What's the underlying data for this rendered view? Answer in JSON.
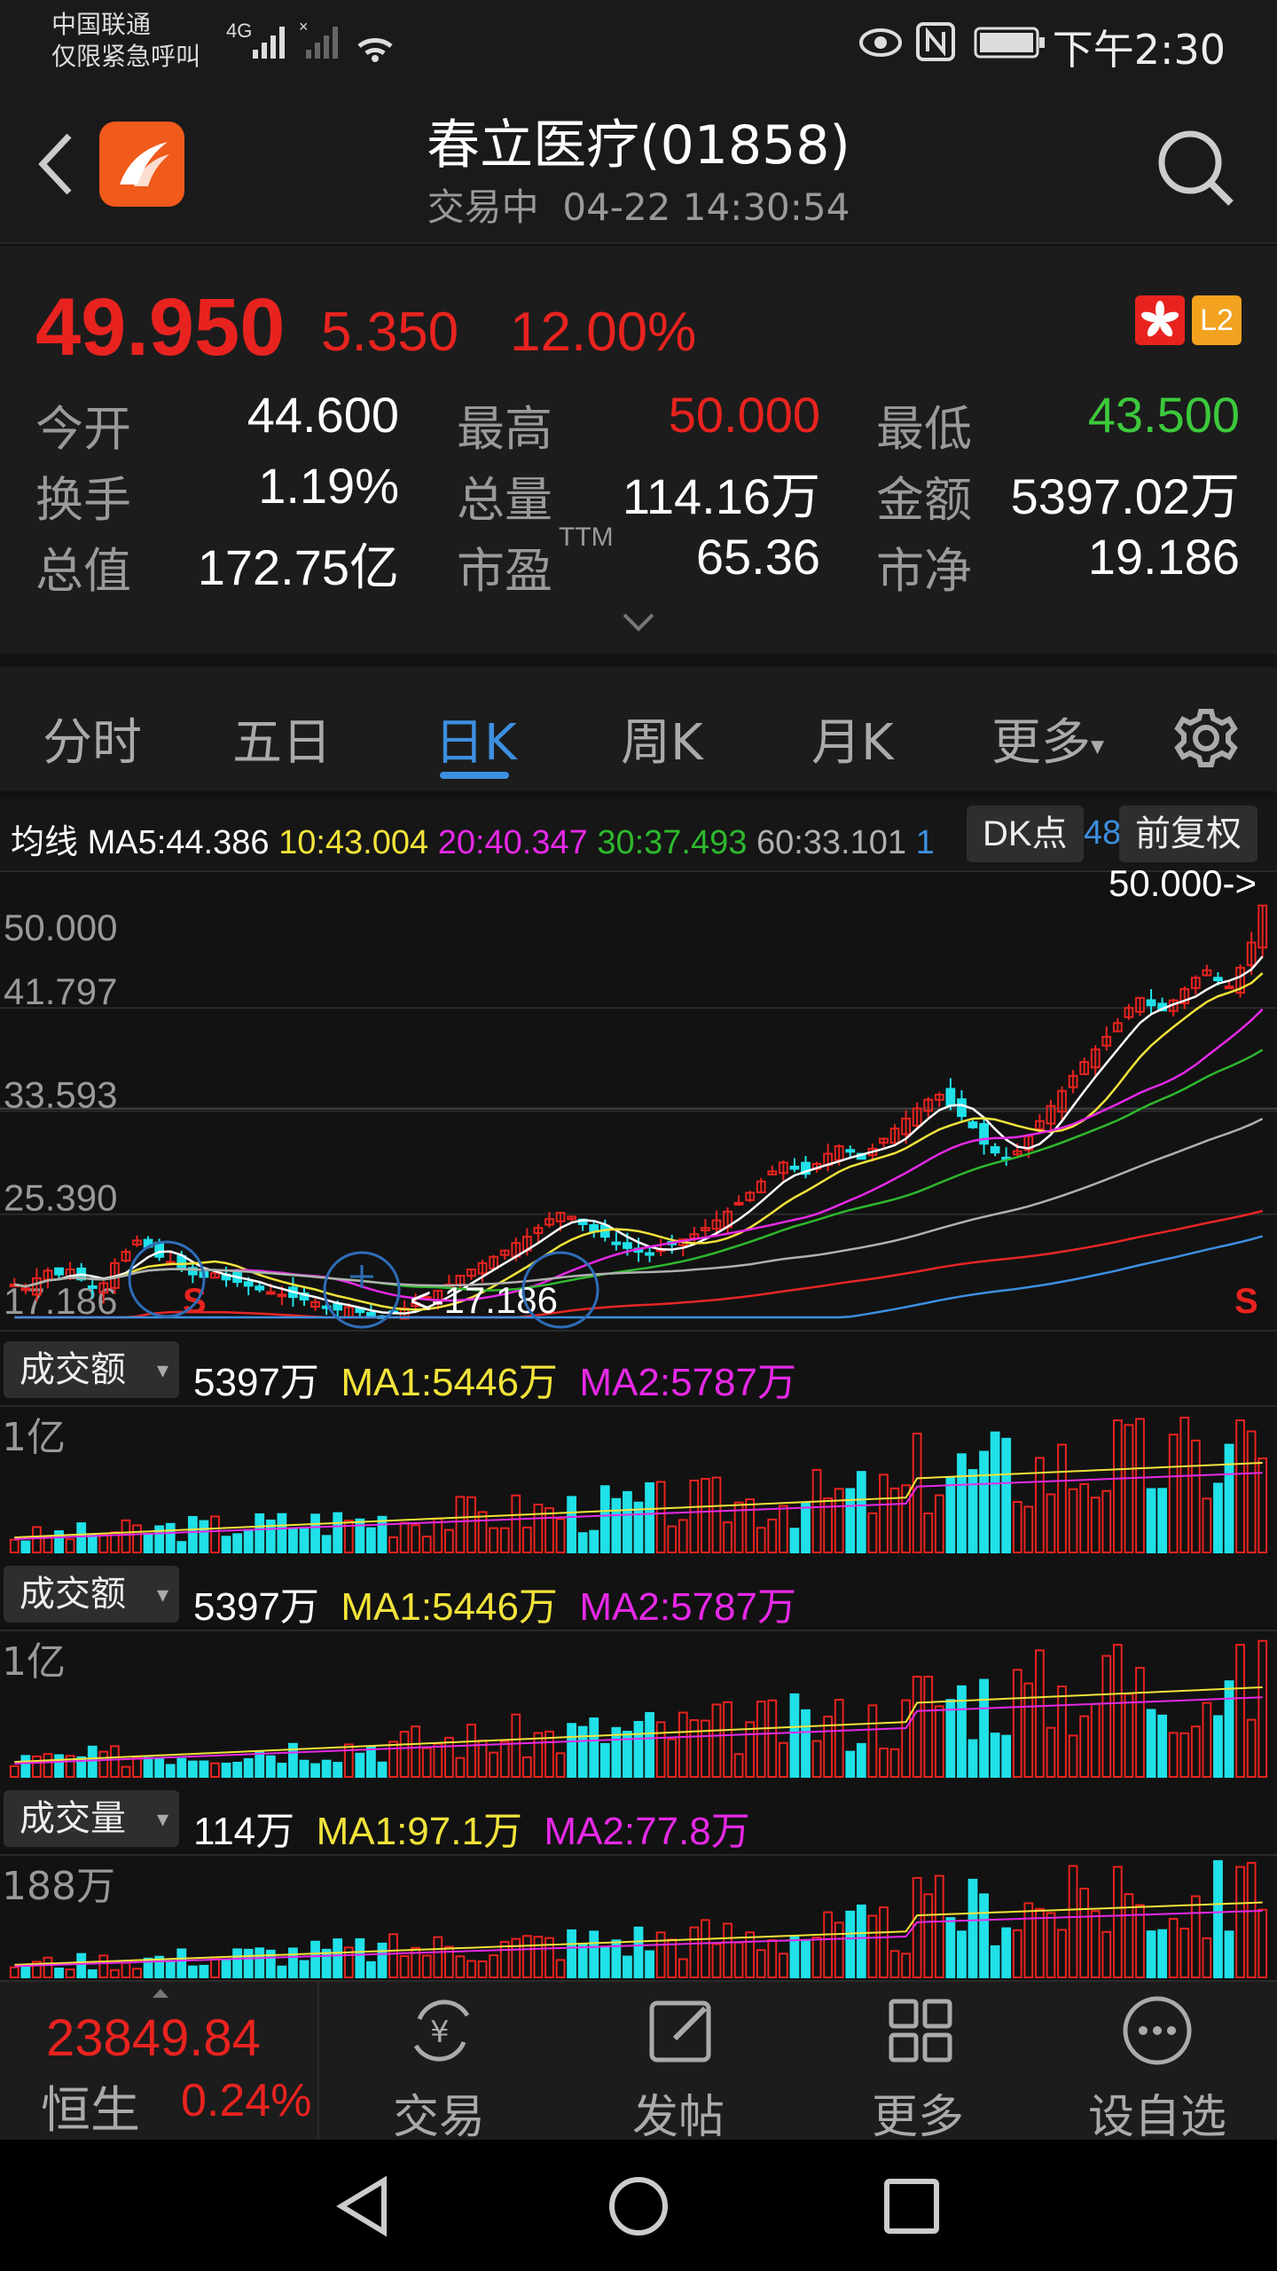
{
  "status_bar": {
    "carrier_line1": "中国联通",
    "carrier_line2": "仅限紧急呼叫",
    "network": "4G",
    "time": "下午2:30"
  },
  "header": {
    "title": "春立医疗(01858)",
    "status": "交易中",
    "datetime": "04-22 14:30:54"
  },
  "quote": {
    "price": "49.950",
    "change": "5.350",
    "change_pct": "12.00%",
    "badge_level": "L2",
    "stats": [
      {
        "label": "今开",
        "value": "44.600",
        "color": "#ffffff"
      },
      {
        "label": "最高",
        "value": "50.000",
        "color": "#e8231f"
      },
      {
        "label": "最低",
        "value": "43.500",
        "color": "#3cc93c"
      },
      {
        "label": "换手",
        "value": "1.19%",
        "color": "#ffffff"
      },
      {
        "label": "总量",
        "value": "114.16万",
        "color": "#ffffff"
      },
      {
        "label": "金额",
        "value": "5397.02万",
        "color": "#ffffff"
      },
      {
        "label": "总值",
        "value": "172.75亿",
        "color": "#ffffff"
      },
      {
        "label": "市盈",
        "sup": "TTM",
        "value": "65.36",
        "color": "#ffffff"
      },
      {
        "label": "市净",
        "value": "19.186",
        "color": "#ffffff"
      }
    ]
  },
  "tabs": [
    "分时",
    "五日",
    "日K",
    "周K",
    "月K",
    "更多"
  ],
  "active_tab": "日K",
  "ma_line": {
    "label": "均线",
    "ma5": "MA5:44.386",
    "ma10": "10:43.004",
    "ma20": "20:40.347",
    "ma30": "30:37.493",
    "ma60": "60:33.101",
    "ma_cut": "1",
    "ma_cut2": "48",
    "dk_button": "DK点",
    "adjust_button": "前复权"
  },
  "chart_data": {
    "type": "candlestick",
    "y_ticks": [
      "50.000",
      "41.797",
      "33.593",
      "25.390",
      "17.186"
    ],
    "high_label": "50.000->",
    "low_label": "<-17.186",
    "signal_label": "S",
    "ylim": [
      17.186,
      50.0
    ],
    "approx_close": [
      19.8,
      19.5,
      20.3,
      20.9,
      20.6,
      21.0,
      20.2,
      19.6,
      19.9,
      21.5,
      22.4,
      23.3,
      22.8,
      22.0,
      21.6,
      21.0,
      20.6,
      20.4,
      20.7,
      20.2,
      20.0,
      19.7,
      19.4,
      19.2,
      19.0,
      18.8,
      18.6,
      18.4,
      18.0,
      17.8,
      18.0,
      17.6,
      17.3,
      17.2,
      17.5,
      17.9,
      18.3,
      18.8,
      19.3,
      19.8,
      20.5,
      21.0,
      21.5,
      22.0,
      22.5,
      23.1,
      23.6,
      24.3,
      25.0,
      25.5,
      25.2,
      24.6,
      24.0,
      23.6,
      23.1,
      22.7,
      22.4,
      22.2,
      22.6,
      23.0,
      23.4,
      23.8,
      24.3,
      24.9,
      25.6,
      26.3,
      27.1,
      28.0,
      28.8,
      29.5,
      29.0,
      28.6,
      29.4,
      30.2,
      30.8,
      30.4,
      29.8,
      30.6,
      31.4,
      32.2,
      33.0,
      33.8,
      34.5,
      34.9,
      34.0,
      33.2,
      32.3,
      31.0,
      30.3,
      29.8,
      30.4,
      31.6,
      32.8,
      34.0,
      35.2,
      36.4,
      37.5,
      38.5,
      39.5,
      40.6,
      41.8,
      42.6,
      42.0,
      41.6,
      42.4,
      43.3,
      44.2,
      44.8,
      44.0,
      43.5,
      45.0,
      47.0,
      49.95
    ],
    "ma_series": [
      {
        "name": "MA5",
        "color": "#ffffff"
      },
      {
        "name": "MA10",
        "color": "#f2e33a"
      },
      {
        "name": "MA20",
        "color": "#e629e6"
      },
      {
        "name": "MA30",
        "color": "#2eb82e"
      },
      {
        "name": "MA60",
        "color": "#b0b0b0"
      },
      {
        "name": "MA120",
        "color": "#e62626"
      },
      {
        "name": "MA250",
        "color": "#3d8fe0"
      }
    ]
  },
  "sub_charts": [
    {
      "dropdown": "成交额",
      "value": "5397万",
      "ma1": "MA1:5446万",
      "ma2": "MA2:5787万",
      "scale": "1亿"
    },
    {
      "dropdown": "成交额",
      "value": "5397万",
      "ma1": "MA1:5446万",
      "ma2": "MA2:5787万",
      "scale": "1亿"
    },
    {
      "dropdown": "成交量",
      "value": "114万",
      "ma1": "MA1:97.1万",
      "ma2": "MA2:77.8万",
      "scale": "188万"
    }
  ],
  "bottom_bar": {
    "index_value": "23849.84",
    "index_name": "恒生",
    "index_pct": "0.24%",
    "items": [
      {
        "label": "交易",
        "icon": "yen-cycle-icon"
      },
      {
        "label": "发帖",
        "icon": "edit-icon"
      },
      {
        "label": "更多",
        "icon": "grid-icon"
      },
      {
        "label": "设自选",
        "icon": "ellipsis-circle-icon"
      }
    ]
  },
  "colors": {
    "up": "#e8231f",
    "down": "#20e0e8",
    "accent": "#3d8fe0",
    "ma1": "#f2e33a",
    "ma2": "#e629e6"
  }
}
